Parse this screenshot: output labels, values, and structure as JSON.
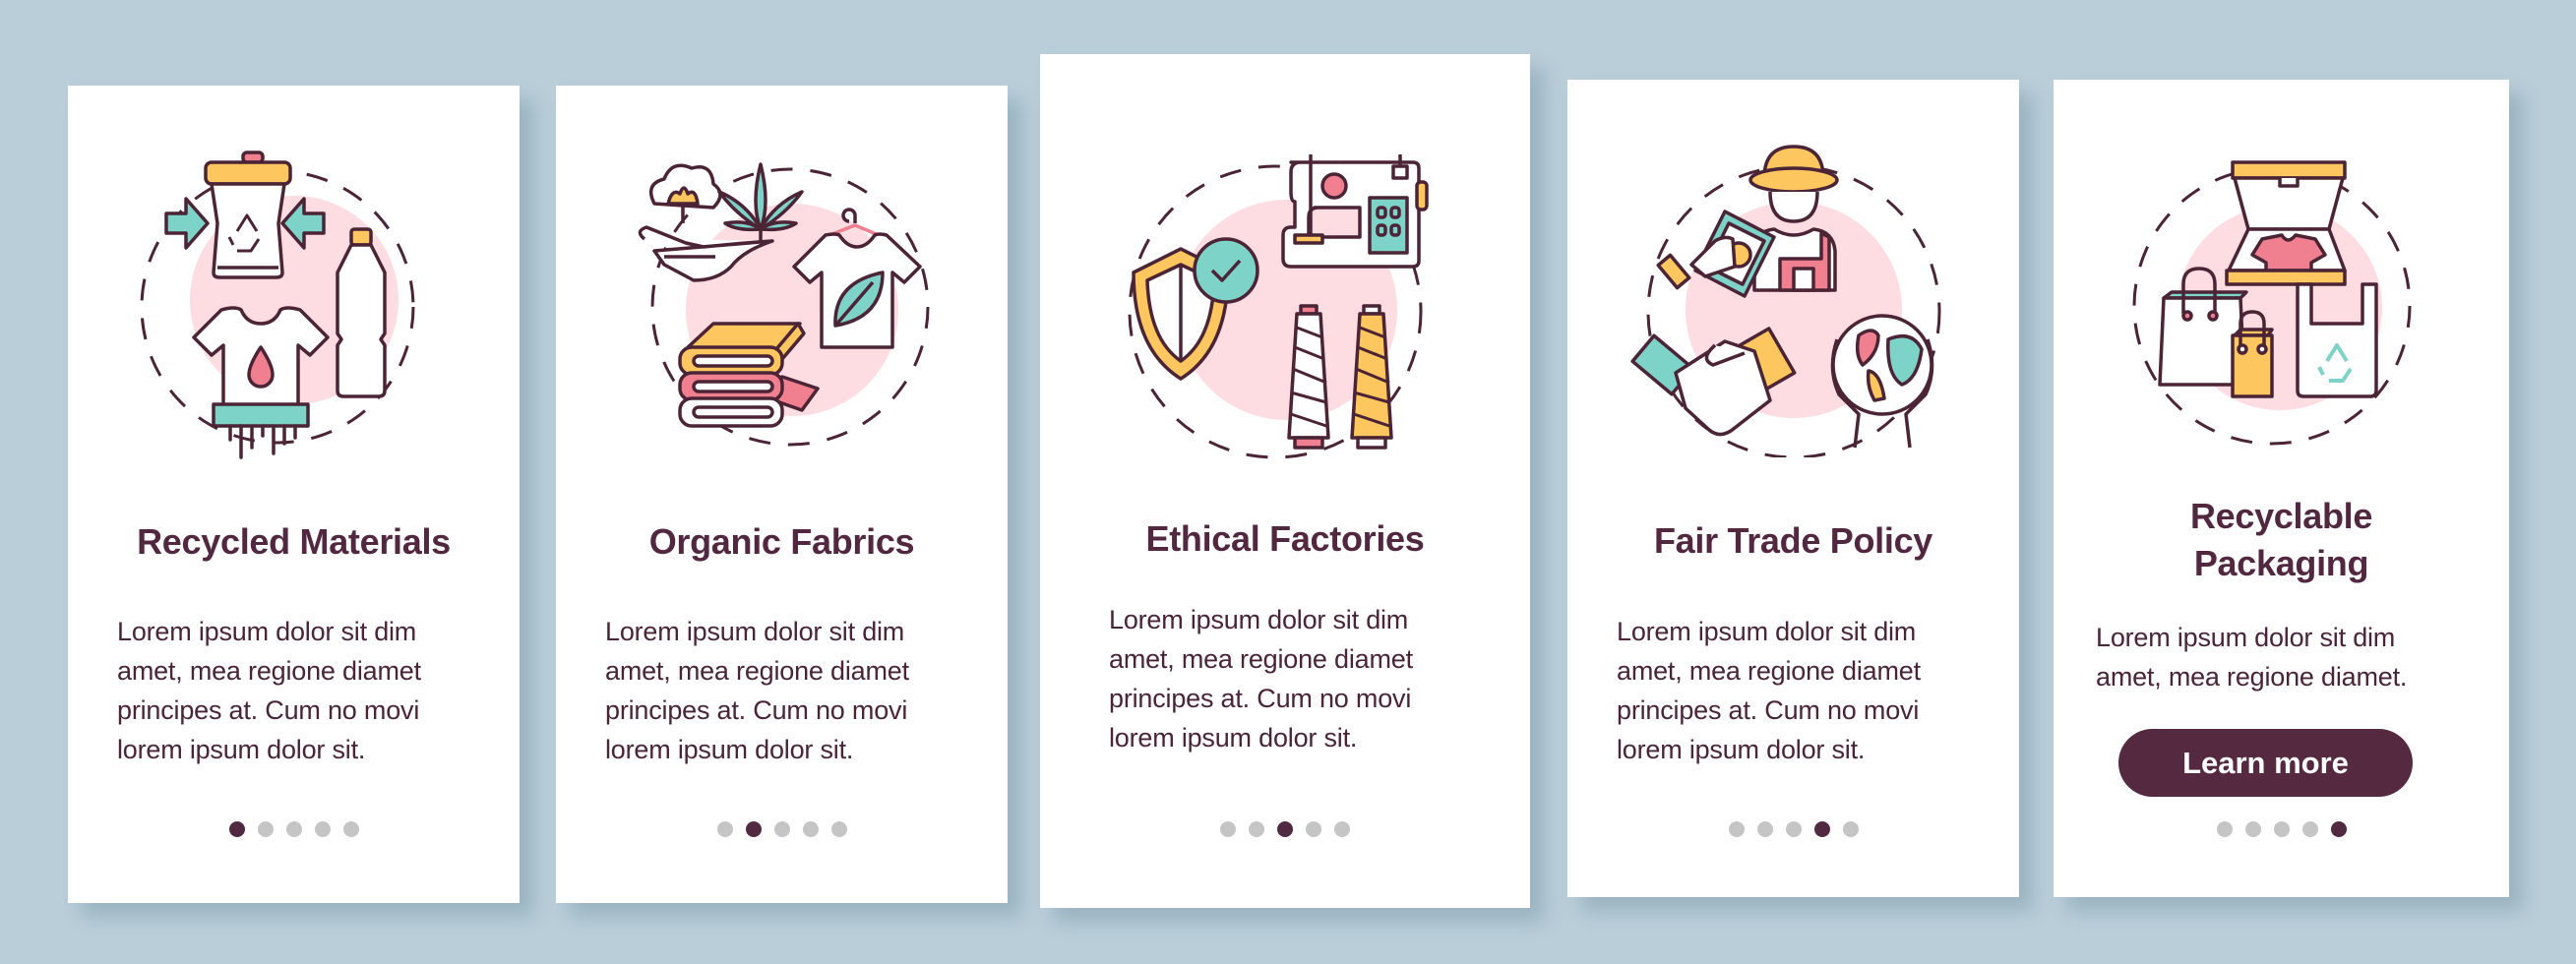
{
  "palette": {
    "background": "#b9ced9",
    "card": "#ffffff",
    "title": "#522840",
    "body_text": "#4a2438",
    "outline": "#4b2436",
    "pink_circle": "#fddde2",
    "teal": "#7dd3c8",
    "yellow": "#fdc65e",
    "pink": "#f0808f",
    "dot_active": "#512a42",
    "dot_inactive": "#c5c5c5",
    "button": "#552a40"
  },
  "cards": [
    {
      "illustration": "recycled-materials-illustration",
      "title": "Recycled Materials",
      "body": "Lorem ipsum dolor sit dim\namet, mea regione diamet\nprincipes at. Cum no movi\nlorem ipsum dolor sit.",
      "active_page": 1
    },
    {
      "illustration": "organic-fabrics-illustration",
      "title": "Organic Fabrics",
      "body": "Lorem ipsum dolor sit dim\namet, mea regione diamet\nprincipes at. Cum no movi\nlorem ipsum dolor sit.",
      "active_page": 2
    },
    {
      "illustration": "ethical-factories-illustration",
      "title": "Ethical Factories",
      "body": "Lorem ipsum dolor sit dim\namet, mea regione diamet\nprincipes at. Cum no movi\nlorem ipsum dolor sit.",
      "active_page": 3
    },
    {
      "illustration": "fair-trade-illustration",
      "title": "Fair Trade Policy",
      "body": "Lorem ipsum dolor sit dim\namet, mea regione diamet\nprincipes at. Cum no movi\nlorem ipsum dolor sit.",
      "active_page": 4
    },
    {
      "illustration": "recyclable-packaging-illustration",
      "title": "Recyclable\nPackaging",
      "body": "Lorem ipsum dolor sit dim\namet, mea regione diamet.",
      "button_label": "Learn more",
      "active_page": 5
    }
  ],
  "pagination": {
    "total_pages": 5
  }
}
